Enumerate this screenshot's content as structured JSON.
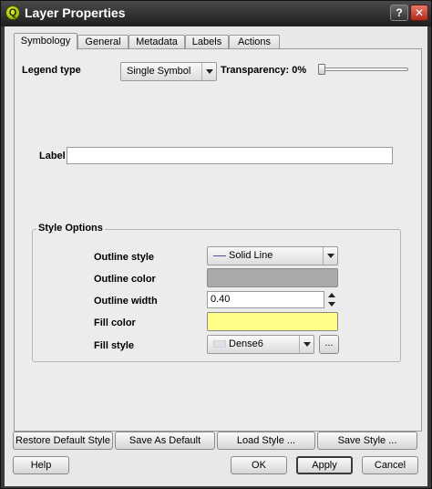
{
  "window": {
    "title": "Layer Properties",
    "help_glyph": "?",
    "close_glyph": "✕",
    "app_icon_letter": "Q"
  },
  "tabs": [
    {
      "label": "Symbology",
      "active": true
    },
    {
      "label": "General",
      "active": false
    },
    {
      "label": "Metadata",
      "active": false
    },
    {
      "label": "Labels",
      "active": false
    },
    {
      "label": "Actions",
      "active": false
    }
  ],
  "symbology": {
    "legend_type_label": "Legend type",
    "legend_type_value": "Single Symbol",
    "transparency_label": "Transparency: 0%",
    "transparency_value": 0,
    "label_field_label": "Label",
    "label_field_value": ""
  },
  "style_options": {
    "title": "Style Options",
    "outline_style_label": "Outline style",
    "outline_style_value": "Solid Line",
    "outline_color_label": "Outline color",
    "outline_color": "#aaaaaa",
    "outline_width_label": "Outline width",
    "outline_width_value": "0.40",
    "fill_color_label": "Fill color",
    "fill_color": "#ffff88",
    "fill_style_label": "Fill style",
    "fill_style_value": "Dense6",
    "fill_style_more": "..."
  },
  "buttons": {
    "restore_default": "Restore Default Style",
    "save_as_default": "Save As Default",
    "load_style": "Load Style ...",
    "save_style": "Save Style ...",
    "help": "Help",
    "ok": "OK",
    "apply": "Apply",
    "cancel": "Cancel"
  }
}
